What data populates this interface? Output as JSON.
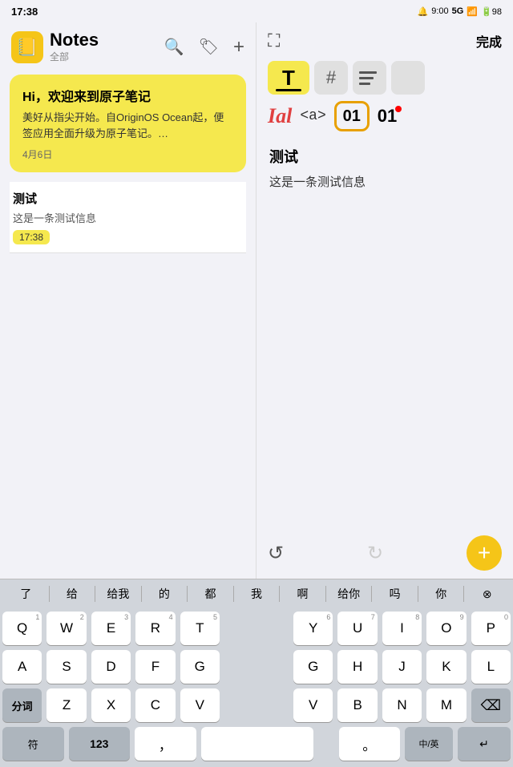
{
  "statusBar": {
    "time": "17:38",
    "icons": "🔔 9:00 5G ▲ 📶 🔋98"
  },
  "leftPanel": {
    "appTitle": "Notes",
    "appSubtitle": "全部",
    "headerIcons": {
      "search": "🔍",
      "tag": "🏷",
      "add": "+"
    },
    "notes": [
      {
        "title": "Hi，欢迎来到原子笔记",
        "body": "美好从指尖开始。自OriginOS Ocean起，便签应用全面升级为原子笔记。…",
        "date": "4月6日",
        "style": "yellow"
      },
      {
        "title": "测试",
        "body": "这是一条测试信息",
        "time": "17:38",
        "style": "white"
      }
    ]
  },
  "rightPanel": {
    "doneLabel": "完成",
    "noteTitle": "测试",
    "noteBody": "这是一条测试信息",
    "formatButtons": {
      "T": "T",
      "hash": "#",
      "italic": "Ial",
      "code": "<a>",
      "num01circled": "01",
      "num01dot": "01"
    },
    "undoSymbol": "↺",
    "redoSymbol": "↻",
    "addSymbol": "+"
  },
  "keyboard": {
    "suggestions": [
      "了",
      "给",
      "给我",
      "的",
      "都",
      "我",
      "啊",
      "给你",
      "吗",
      "你"
    ],
    "rows": [
      [
        "Q",
        "W",
        "E",
        "R",
        "T",
        "",
        "Y",
        "U",
        "I",
        "O",
        "P"
      ],
      [
        "A",
        "S",
        "D",
        "F",
        "G",
        "",
        "G",
        "H",
        "J",
        "K",
        "L"
      ],
      [
        "分词",
        "Z",
        "X",
        "C",
        "V",
        "",
        "V",
        "B",
        "N",
        "M",
        "⌫"
      ],
      [
        "符",
        "123",
        "，",
        "_space_",
        "",
        "",
        "。",
        "中/英",
        "↵"
      ]
    ]
  }
}
